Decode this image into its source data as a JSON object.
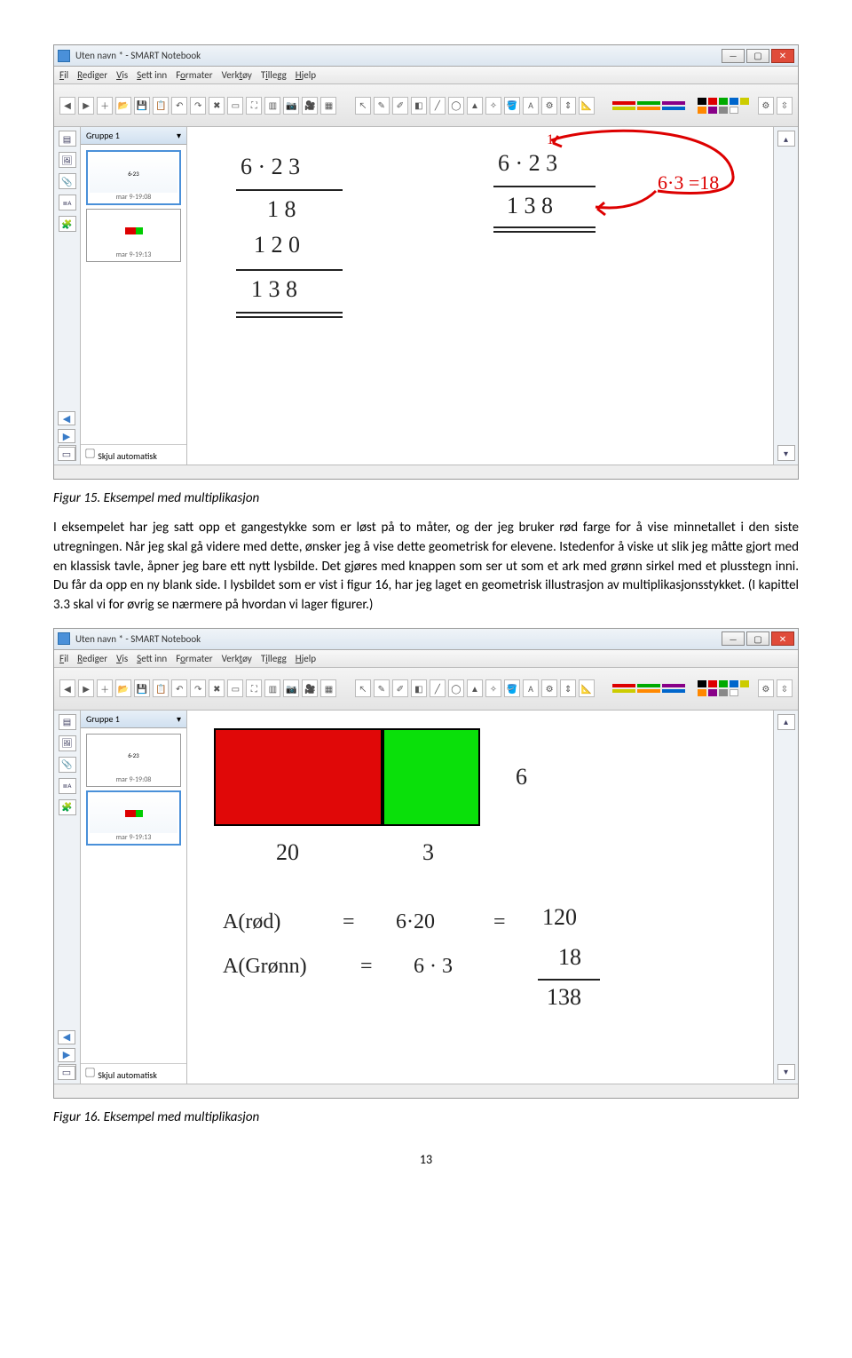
{
  "app": {
    "title": "Uten navn * - SMART Notebook",
    "menu": {
      "fil": "Fil",
      "rediger": "Rediger",
      "vis": "Vis",
      "settinn": "Sett inn",
      "formater": "Formater",
      "verktoy": "Verktøy",
      "tillegg": "Tillegg",
      "hjelp": "Hjelp"
    },
    "sidebar_group": "Gruppe 1",
    "thumb1_time": "mar 9-19:08",
    "thumb2_time": "mar 9-19:13",
    "hide_auto": "Skjul automatisk"
  },
  "fig15": {
    "caption": "Figur 15. Eksempel med multiplikasjon",
    "body": "I eksempelet har jeg satt opp et gangestykke som er løst på to måter, og der jeg bruker rød farge for å vise minnetallet i den siste utregningen. Når jeg skal gå videre med dette, ønsker jeg å vise dette geometrisk for elevene. Istedenfor å viske ut slik jeg måtte gjort med en klassisk tavle, åpner jeg bare ett nytt lysbilde. Det gjøres med knappen som ser ut som et ark med grønn sirkel med et plusstegn inni. Du får da opp en ny blank side. I lysbildet som er vist i figur 16, har jeg laget en geometrisk illustrasjon av multiplikasjonsstykket. (I kapittel 3.3 skal vi for øvrig se nærmere på hvordan vi lager figurer.)",
    "hw": {
      "left_expr": "6 · 2 3",
      "left_18": "1 8",
      "left_120": "1 2 0",
      "left_138": "1 3 8",
      "right_carry": "1",
      "right_expr": "6 · 2 3",
      "right_138": "1 3 8",
      "right_note": "6·3 =18"
    }
  },
  "fig16": {
    "caption": "Figur 16. Eksempel med multiplikasjon",
    "hw": {
      "label6": "6",
      "label20": "20",
      "label3": "3",
      "line1a": "A(rød)",
      "line1b": "=",
      "line1c": "6·20",
      "line1d": "=",
      "line1e": "120",
      "line2a": "A(Grønn)",
      "line2b": "=",
      "line2c": "6 · 3",
      "line2e": "18",
      "line3": "138"
    }
  },
  "page_number": "13"
}
